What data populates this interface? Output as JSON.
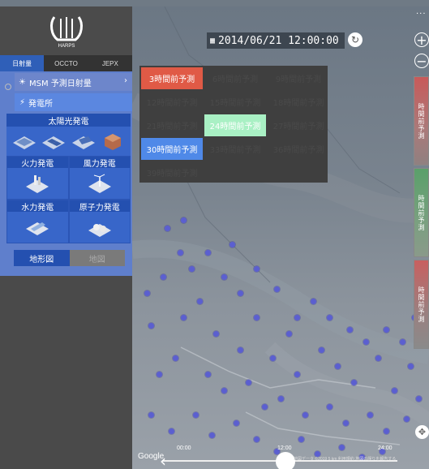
{
  "sidebar": {
    "tabs": [
      "日射量",
      "OCCTO",
      "JEPX"
    ],
    "active_tab": 0,
    "logo_text": "HARPS",
    "msm_label": "MSM 予測日射量",
    "plant_label": "発電所",
    "solar_title": "太陽光発電",
    "categories": [
      "火力発電",
      "風力発電",
      "水力発電",
      "原子力発電"
    ],
    "maptypes": [
      "地形図",
      "地図"
    ]
  },
  "timebar": {
    "datetime": "2014/06/21 12:00:00"
  },
  "forecast": {
    "items": [
      "3時間前予測",
      "6時間前予測",
      "9時間前予測",
      "12時間前予測",
      "15時間前予測",
      "18時間前予測",
      "21時間前予測",
      "24時間前予測",
      "27時間前予測",
      "30時間前予測",
      "33時間前予測",
      "36時間前予測",
      "39時間前予測"
    ],
    "colors": {
      "red": "#e05a46",
      "green": "#a9f0c4",
      "blue": "#4f89e8"
    }
  },
  "legend": [
    "時間前予測",
    "時間前予測",
    "時間前予測"
  ],
  "timeline": {
    "labels": [
      "00:00",
      "12:00",
      "24:00"
    ],
    "google": "Google",
    "attribution": "地図データ ©2019   5 km   利用規約   地図の誤りを報告する"
  },
  "icons": {
    "zoom_in": "plus-circle-icon",
    "zoom_out": "minus-circle-icon",
    "refresh": "refresh-icon",
    "calendar": "calendar-icon",
    "compass": "compass-icon"
  }
}
